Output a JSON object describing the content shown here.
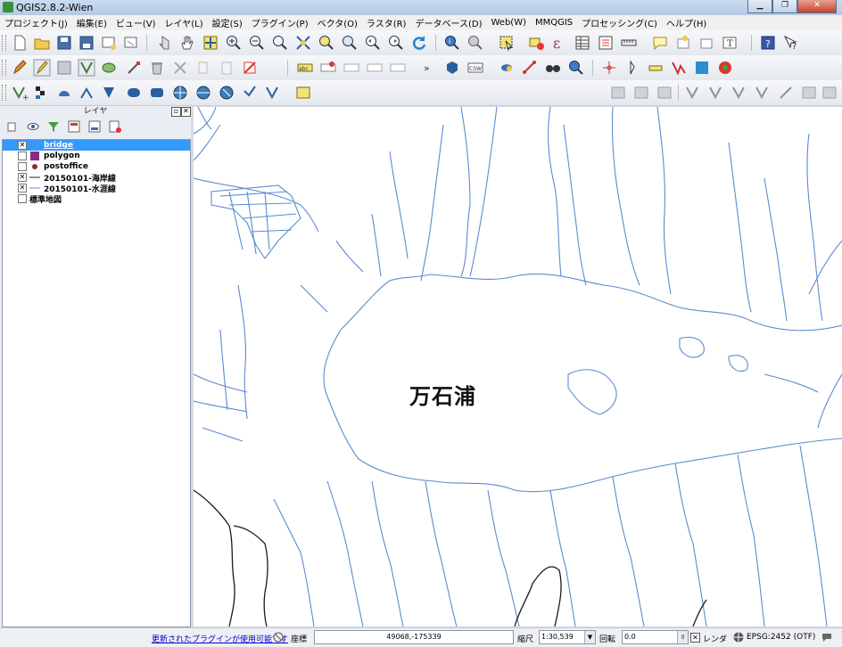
{
  "window": {
    "title": "QGIS2.8.2-Wien"
  },
  "menu": [
    "プロジェクト(J)",
    "編集(E)",
    "ビュー(V)",
    "レイヤ(L)",
    "設定(S)",
    "プラグイン(P)",
    "ベクタ(O)",
    "ラスタ(R)",
    "データベース(D)",
    "Web(W)",
    "MMQGIS",
    "プロセッシング(C)",
    "ヘルプ(H)"
  ],
  "layers_panel": {
    "title": "レイヤ",
    "layers": [
      {
        "name": "bridge",
        "checked": true,
        "selected": true,
        "symbol": "line-icon",
        "color": "#5b8bd0"
      },
      {
        "name": "polygon",
        "checked": false,
        "selected": false,
        "symbol": "polygon-icon",
        "color": "#8e2a86"
      },
      {
        "name": "postoffice",
        "checked": false,
        "selected": false,
        "symbol": "point-icon",
        "color": "#8e2a3a"
      },
      {
        "name": "20150101-海岸線",
        "checked": true,
        "selected": false,
        "symbol": "line-icon",
        "color": "#222222"
      },
      {
        "name": "20150101-水涯線",
        "checked": true,
        "selected": false,
        "symbol": "line-icon",
        "color": "#5b8bd0"
      },
      {
        "name": "標準地図",
        "checked": false,
        "selected": false,
        "symbol": "raster-icon",
        "color": "#ffffff"
      }
    ]
  },
  "map": {
    "label": "万石浦",
    "water_color": "#5b8bd0",
    "coast_color": "#1a1a1a"
  },
  "status": {
    "plugin_notice": "更新されたプラグインが使用可能です",
    "coord_label": "座標",
    "coord_value": "49068,-175339",
    "scale_label": "縮尺",
    "scale_value": "1:30,539",
    "rotation_label": "回転",
    "rotation_value": "0.0",
    "render_label": "レンダ",
    "crs": "EPSG:2452 (OTF)"
  }
}
